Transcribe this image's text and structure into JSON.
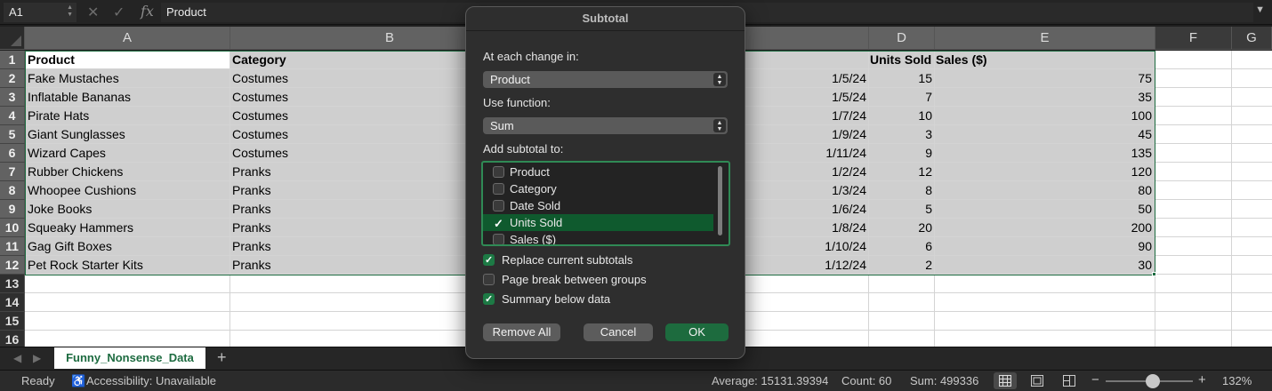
{
  "formula_bar": {
    "name_box": "A1",
    "formula": "Product"
  },
  "columns": [
    "A",
    "B",
    "C",
    "D",
    "E",
    "F",
    "G"
  ],
  "rows": [
    "1",
    "2",
    "3",
    "4",
    "5",
    "6",
    "7",
    "8",
    "9",
    "10",
    "11",
    "12",
    "13",
    "14",
    "15",
    "16"
  ],
  "sheet": {
    "headers": {
      "product": "Product",
      "category": "Category",
      "units": "Units Sold",
      "sales": "Sales ($)"
    },
    "records": [
      {
        "product": "Fake Mustaches",
        "category": "Costumes",
        "date": "1/5/24",
        "units": "15",
        "sales": "75"
      },
      {
        "product": "Inflatable Bananas",
        "category": "Costumes",
        "date": "1/5/24",
        "units": "7",
        "sales": "35"
      },
      {
        "product": "Pirate Hats",
        "category": "Costumes",
        "date": "1/7/24",
        "units": "10",
        "sales": "100"
      },
      {
        "product": "Giant Sunglasses",
        "category": "Costumes",
        "date": "1/9/24",
        "units": "3",
        "sales": "45"
      },
      {
        "product": "Wizard Capes",
        "category": "Costumes",
        "date": "1/11/24",
        "units": "9",
        "sales": "135"
      },
      {
        "product": "Rubber Chickens",
        "category": "Pranks",
        "date": "1/2/24",
        "units": "12",
        "sales": "120"
      },
      {
        "product": "Whoopee Cushions",
        "category": "Pranks",
        "date": "1/3/24",
        "units": "8",
        "sales": "80"
      },
      {
        "product": "Joke Books",
        "category": "Pranks",
        "date": "1/6/24",
        "units": "5",
        "sales": "50"
      },
      {
        "product": "Squeaky Hammers",
        "category": "Pranks",
        "date": "1/8/24",
        "units": "20",
        "sales": "200"
      },
      {
        "product": "Gag Gift Boxes",
        "category": "Pranks",
        "date": "1/10/24",
        "units": "6",
        "sales": "90"
      },
      {
        "product": "Pet Rock Starter Kits",
        "category": "Pranks",
        "date": "1/12/24",
        "units": "2",
        "sales": "30"
      }
    ]
  },
  "sheet_tabs": {
    "active": "Funny_Nonsense_Data",
    "add_label": "+"
  },
  "status_bar": {
    "ready": "Ready",
    "accessibility": "Accessibility: Unavailable",
    "average": "Average: 15131.39394",
    "count": "Count: 60",
    "sum": "Sum: 499336",
    "zoom": "132%",
    "zoom_minus": "−",
    "zoom_plus": "+"
  },
  "dialog": {
    "title": "Subtotal",
    "change_label": "At each change in:",
    "change_value": "Product",
    "function_label": "Use function:",
    "function_value": "Sum",
    "add_label": "Add subtotal to:",
    "fields": [
      {
        "label": "Product",
        "checked": false,
        "selected": false
      },
      {
        "label": "Category",
        "checked": false,
        "selected": false
      },
      {
        "label": "Date Sold",
        "checked": false,
        "selected": false
      },
      {
        "label": "Units Sold",
        "checked": true,
        "selected": true
      },
      {
        "label": "Sales ($)",
        "checked": false,
        "selected": false
      }
    ],
    "options": [
      {
        "label": "Replace current subtotals",
        "checked": true
      },
      {
        "label": "Page break between groups",
        "checked": false
      },
      {
        "label": "Summary below data",
        "checked": true
      }
    ],
    "buttons": {
      "remove_all": "Remove All",
      "cancel": "Cancel",
      "ok": "OK"
    }
  },
  "colors": {
    "accent": "#1d6b40",
    "selection_fill": "#cfcfcf",
    "dialog_bg": "#2e2e2e"
  }
}
